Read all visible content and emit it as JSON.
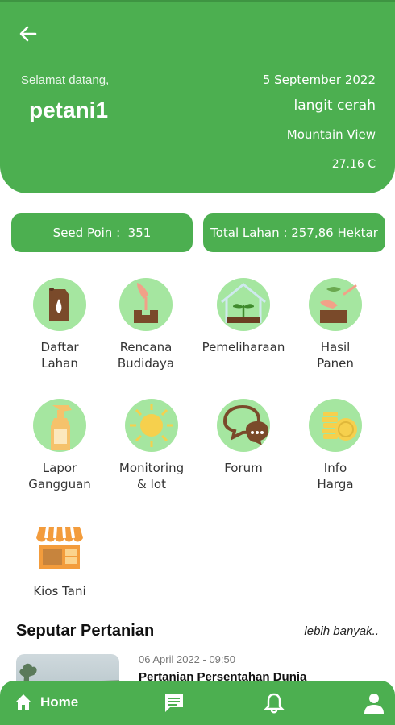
{
  "header": {
    "welcome": "Selamat datang,",
    "username": "petani1",
    "date": "5 September 2022",
    "weather": "langit cerah",
    "location": "Mountain View",
    "temperature": "27.16 C"
  },
  "stats": {
    "seed_label": "Seed Poin :",
    "seed_value": "351",
    "lahan_label": "Total Lahan : 257,86 Hektar"
  },
  "menu": [
    {
      "line1": "Daftar",
      "line2": "Lahan",
      "icon": "soil-bag-icon"
    },
    {
      "line1": "Rencana",
      "line2": "Budidaya",
      "icon": "planting-hand-icon"
    },
    {
      "line1": "Pemeliharaan",
      "line2": "",
      "icon": "greenhouse-icon"
    },
    {
      "line1": "Hasil",
      "line2": "Panen",
      "icon": "harvest-icon"
    },
    {
      "line1": "Lapor",
      "line2": "Gangguan",
      "icon": "spray-bottle-icon"
    },
    {
      "line1": "Monitoring",
      "line2": "& Iot",
      "icon": "sun-icon"
    },
    {
      "line1": "Forum",
      "line2": "",
      "icon": "chat-icon"
    },
    {
      "line1": "Info",
      "line2": "Harga",
      "icon": "coins-icon"
    },
    {
      "line1": "Kios Tani",
      "line2": "",
      "icon": "store-icon"
    }
  ],
  "news": {
    "section_title": "Seputar Pertanian",
    "more_label": "lebih banyak..",
    "items": [
      {
        "date": "06 April 2022 - 09:50",
        "title": "Pertanian Persentahan Dunia"
      }
    ]
  },
  "nav": {
    "home_label": "Home"
  },
  "colors": {
    "primary": "#4caf50",
    "icon_bg": "#a5e6a0"
  }
}
